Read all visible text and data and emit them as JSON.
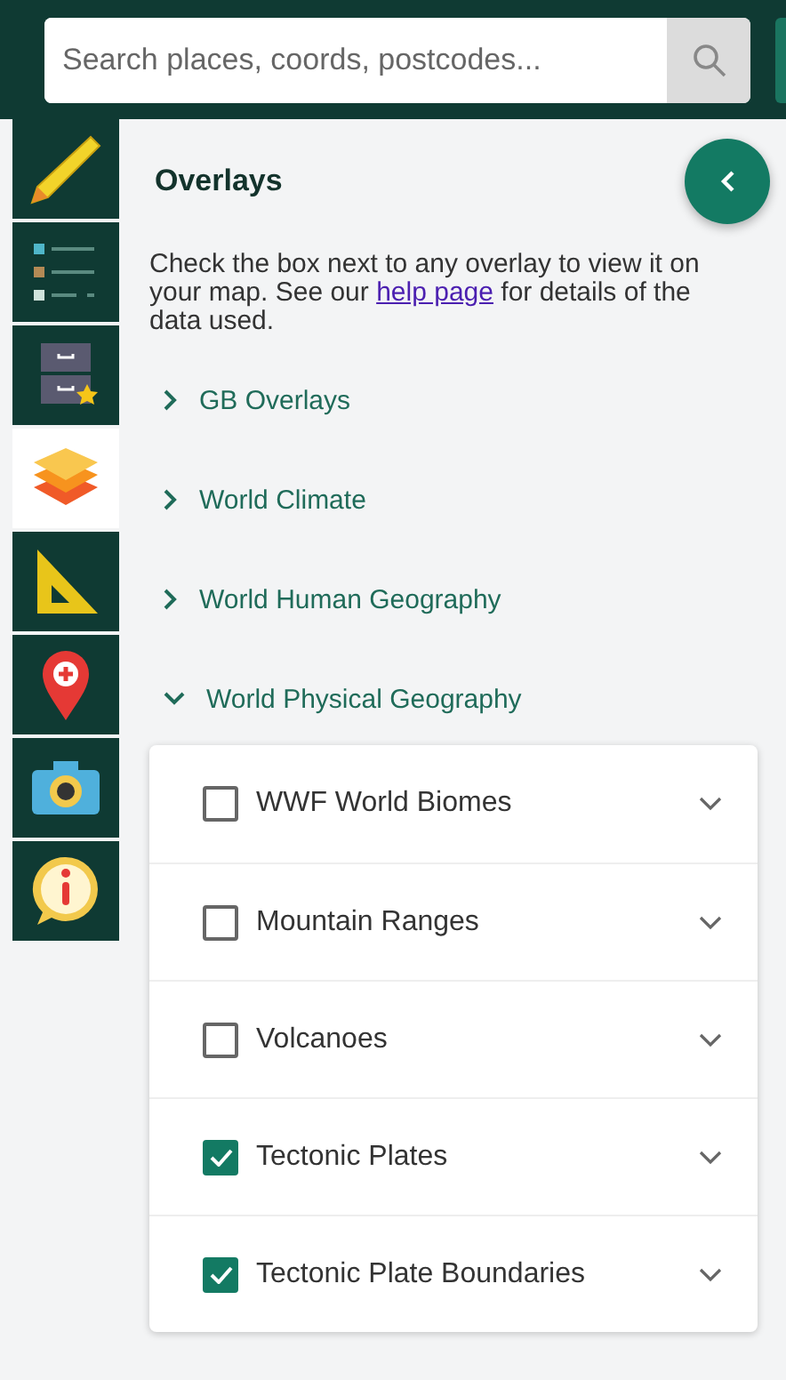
{
  "search": {
    "placeholder": "Search places, coords, postcodes..."
  },
  "toolbar": [
    {
      "kind": "pencil",
      "selected": false
    },
    {
      "kind": "legend",
      "selected": false
    },
    {
      "kind": "drawer",
      "selected": false
    },
    {
      "kind": "layers",
      "selected": true
    },
    {
      "kind": "ruler",
      "selected": false
    },
    {
      "kind": "pin",
      "selected": false
    },
    {
      "kind": "camera",
      "selected": false
    },
    {
      "kind": "info",
      "selected": false
    }
  ],
  "panel": {
    "title": "Overlays",
    "description": {
      "before": "Check the box next to any overlay to view it on your map. See our ",
      "link": "help page",
      "after": " for details of the data used."
    },
    "groups": [
      {
        "label": "GB Overlays",
        "expanded": false
      },
      {
        "label": "World Climate",
        "expanded": false
      },
      {
        "label": "World Human Geography",
        "expanded": false
      },
      {
        "label": "World Physical Geography",
        "expanded": true,
        "items": [
          {
            "label": "WWF World Biomes",
            "checked": false
          },
          {
            "label": "Mountain Ranges",
            "checked": false
          },
          {
            "label": "Volcanoes",
            "checked": false
          },
          {
            "label": "Tectonic Plates",
            "checked": true
          },
          {
            "label": "Tectonic Plate Boundaries",
            "checked": true
          }
        ]
      }
    ]
  }
}
